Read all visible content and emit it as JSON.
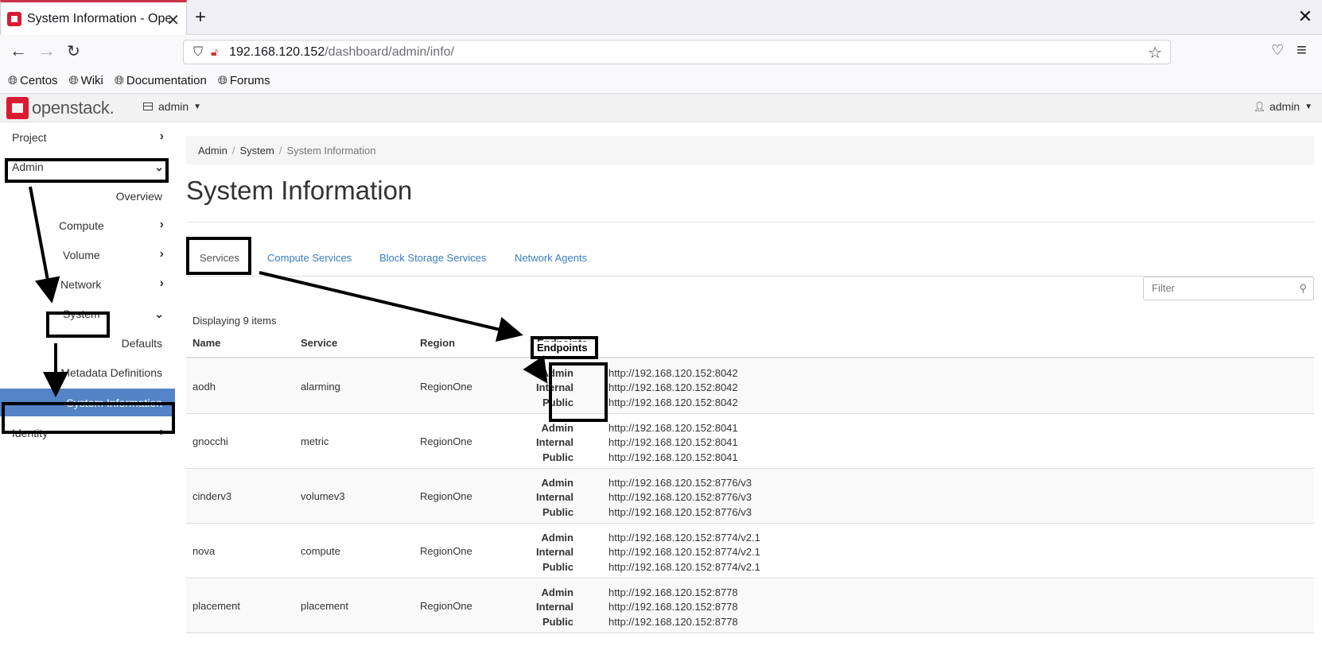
{
  "browser": {
    "tab_title": "System Information - Ope",
    "url_host": "192.168.120.152",
    "url_path": "/dashboard/admin/info/",
    "bookmarks": [
      "Centos",
      "Wiki",
      "Documentation",
      "Forums"
    ]
  },
  "header": {
    "logo_text": "openstack.",
    "project": "admin",
    "user": "admin"
  },
  "sidebar": {
    "project": "Project",
    "admin": "Admin",
    "overview": "Overview",
    "compute": "Compute",
    "volume": "Volume",
    "network": "Network",
    "system": "System",
    "defaults": "Defaults",
    "metadata": "Metadata Definitions",
    "sysinfo": "System Information",
    "identity": "Identity"
  },
  "breadcrumb": {
    "admin": "Admin",
    "system": "System",
    "current": "System Information"
  },
  "page": {
    "title": "System Information",
    "filter_placeholder": "Filter",
    "count": "Displaying 9 items"
  },
  "tabs": [
    "Services",
    "Compute Services",
    "Block Storage Services",
    "Network Agents"
  ],
  "table": {
    "headers": {
      "name": "Name",
      "service": "Service",
      "region": "Region",
      "endpoints": "Endpoints"
    },
    "endpoint_labels": [
      "Admin",
      "Internal",
      "Public"
    ],
    "rows": [
      {
        "name": "aodh",
        "service": "alarming",
        "region": "RegionOne",
        "admin": "http://192.168.120.152:8042",
        "internal": "http://192.168.120.152:8042",
        "public": "http://192.168.120.152:8042"
      },
      {
        "name": "gnocchi",
        "service": "metric",
        "region": "RegionOne",
        "admin": "http://192.168.120.152:8041",
        "internal": "http://192.168.120.152:8041",
        "public": "http://192.168.120.152:8041"
      },
      {
        "name": "cinderv3",
        "service": "volumev3",
        "region": "RegionOne",
        "admin": "http://192.168.120.152:8776/v3",
        "internal": "http://192.168.120.152:8776/v3",
        "public": "http://192.168.120.152:8776/v3"
      },
      {
        "name": "nova",
        "service": "compute",
        "region": "RegionOne",
        "admin": "http://192.168.120.152:8774/v2.1",
        "internal": "http://192.168.120.152:8774/v2.1",
        "public": "http://192.168.120.152:8774/v2.1"
      },
      {
        "name": "placement",
        "service": "placement",
        "region": "RegionOne",
        "admin": "http://192.168.120.152:8778",
        "internal": "http://192.168.120.152:8778",
        "public": "http://192.168.120.152:8778"
      }
    ]
  },
  "colors": {
    "accent_link": "#3a7cc4",
    "sidebar_active": "#5484c7",
    "brand_red": "#da1a32"
  }
}
